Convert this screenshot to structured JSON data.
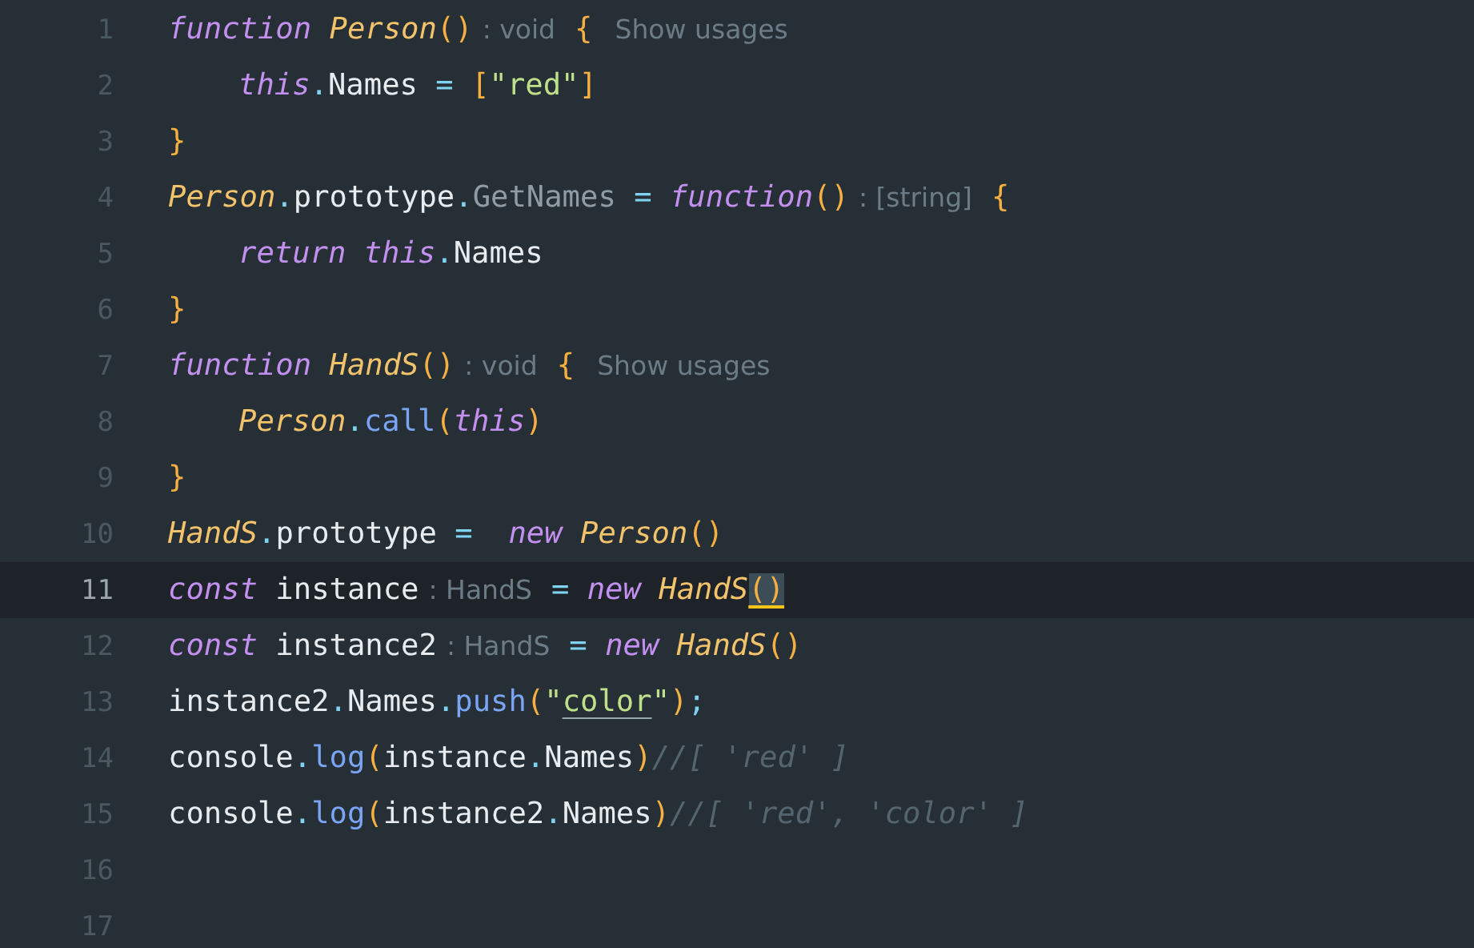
{
  "editor": {
    "lines": [
      {
        "number": "1",
        "current": false,
        "indented": false,
        "tokens": [
          {
            "kind": "keyword",
            "text": "function "
          },
          {
            "kind": "function",
            "text": "Person"
          },
          {
            "kind": "brace",
            "text": "()"
          },
          {
            "kind": "hint",
            "text": ": void"
          },
          {
            "kind": "brace",
            "text": "{"
          },
          {
            "kind": "usages",
            "text": "Show usages"
          }
        ]
      },
      {
        "number": "2",
        "current": false,
        "indented": true,
        "tokens": [
          {
            "kind": "keyword",
            "text": "this"
          },
          {
            "kind": "punct",
            "text": "."
          },
          {
            "kind": "plain",
            "text": "Names"
          },
          {
            "kind": "punct",
            "text": " = "
          },
          {
            "kind": "brace",
            "text": "["
          },
          {
            "kind": "string",
            "text": "\"red\""
          },
          {
            "kind": "brace",
            "text": "]"
          }
        ]
      },
      {
        "number": "3",
        "current": false,
        "indented": false,
        "tokens": [
          {
            "kind": "brace",
            "text": "}"
          }
        ]
      },
      {
        "number": "4",
        "current": false,
        "indented": false,
        "tokens": [
          {
            "kind": "function",
            "text": "Person"
          },
          {
            "kind": "punct",
            "text": "."
          },
          {
            "kind": "plain",
            "text": "prototype"
          },
          {
            "kind": "punct",
            "text": "."
          },
          {
            "kind": "property",
            "text": "GetNames"
          },
          {
            "kind": "punct",
            "text": " = "
          },
          {
            "kind": "keyword",
            "text": "function"
          },
          {
            "kind": "brace",
            "text": "()"
          },
          {
            "kind": "hint",
            "text": ": [string]"
          },
          {
            "kind": "brace",
            "text": "{"
          }
        ]
      },
      {
        "number": "5",
        "current": false,
        "indented": true,
        "tokens": [
          {
            "kind": "keyword",
            "text": "return this"
          },
          {
            "kind": "punct",
            "text": "."
          },
          {
            "kind": "plain",
            "text": "Names"
          }
        ]
      },
      {
        "number": "6",
        "current": false,
        "indented": false,
        "tokens": [
          {
            "kind": "brace",
            "text": "}"
          }
        ]
      },
      {
        "number": "7",
        "current": false,
        "indented": false,
        "tokens": [
          {
            "kind": "keyword",
            "text": "function "
          },
          {
            "kind": "function",
            "text": "HandS"
          },
          {
            "kind": "brace",
            "text": "()"
          },
          {
            "kind": "hint",
            "text": ": void"
          },
          {
            "kind": "brace",
            "text": "{"
          },
          {
            "kind": "usages",
            "text": "Show usages"
          }
        ]
      },
      {
        "number": "8",
        "current": false,
        "indented": true,
        "tokens": [
          {
            "kind": "function",
            "text": "Person"
          },
          {
            "kind": "punct",
            "text": "."
          },
          {
            "kind": "method",
            "text": "call"
          },
          {
            "kind": "brace",
            "text": "("
          },
          {
            "kind": "keyword",
            "text": "this"
          },
          {
            "kind": "brace",
            "text": ")"
          }
        ]
      },
      {
        "number": "9",
        "current": false,
        "indented": false,
        "tokens": [
          {
            "kind": "brace",
            "text": "}"
          }
        ]
      },
      {
        "number": "10",
        "current": false,
        "indented": false,
        "tokens": [
          {
            "kind": "function",
            "text": "HandS"
          },
          {
            "kind": "punct",
            "text": "."
          },
          {
            "kind": "plain",
            "text": "prototype"
          },
          {
            "kind": "punct",
            "text": " =  "
          },
          {
            "kind": "keyword",
            "text": "new "
          },
          {
            "kind": "function",
            "text": "Person"
          },
          {
            "kind": "brace",
            "text": "()"
          }
        ]
      },
      {
        "number": "11",
        "current": true,
        "indented": false,
        "tokens": [
          {
            "kind": "keyword",
            "text": "const"
          },
          {
            "kind": "plain",
            "text": " instance"
          },
          {
            "kind": "hint",
            "text": ": HandS"
          },
          {
            "kind": "punct",
            "text": "= "
          },
          {
            "kind": "keyword",
            "text": "new "
          },
          {
            "kind": "function",
            "text": "HandS"
          },
          {
            "kind": "brace",
            "text": "()",
            "matched": true
          }
        ]
      },
      {
        "number": "12",
        "current": false,
        "indented": false,
        "tokens": [
          {
            "kind": "keyword",
            "text": "const"
          },
          {
            "kind": "plain",
            "text": " instance2"
          },
          {
            "kind": "hint",
            "text": ": HandS"
          },
          {
            "kind": "punct",
            "text": "= "
          },
          {
            "kind": "keyword",
            "text": "new "
          },
          {
            "kind": "function",
            "text": "HandS"
          },
          {
            "kind": "brace",
            "text": "()"
          }
        ]
      },
      {
        "number": "13",
        "current": false,
        "indented": false,
        "tokens": [
          {
            "kind": "plain",
            "text": "instance2"
          },
          {
            "kind": "punct",
            "text": "."
          },
          {
            "kind": "plain",
            "text": "Names"
          },
          {
            "kind": "punct",
            "text": "."
          },
          {
            "kind": "method",
            "text": "push"
          },
          {
            "kind": "brace",
            "text": "("
          },
          {
            "kind": "string",
            "text": "\""
          },
          {
            "kind": "string",
            "text": "color",
            "underlined": true
          },
          {
            "kind": "string",
            "text": "\""
          },
          {
            "kind": "brace",
            "text": ")"
          },
          {
            "kind": "punct",
            "text": ";"
          }
        ]
      },
      {
        "number": "14",
        "current": false,
        "indented": false,
        "tokens": [
          {
            "kind": "plain",
            "text": "console"
          },
          {
            "kind": "punct",
            "text": "."
          },
          {
            "kind": "method",
            "text": "log"
          },
          {
            "kind": "brace",
            "text": "("
          },
          {
            "kind": "plain",
            "text": "instance"
          },
          {
            "kind": "punct",
            "text": "."
          },
          {
            "kind": "plain",
            "text": "Names"
          },
          {
            "kind": "brace",
            "text": ")"
          },
          {
            "kind": "comment",
            "text": "//[ 'red' ]"
          }
        ]
      },
      {
        "number": "15",
        "current": false,
        "indented": false,
        "tokens": [
          {
            "kind": "plain",
            "text": "console"
          },
          {
            "kind": "punct",
            "text": "."
          },
          {
            "kind": "method",
            "text": "log"
          },
          {
            "kind": "brace",
            "text": "("
          },
          {
            "kind": "plain",
            "text": "instance2"
          },
          {
            "kind": "punct",
            "text": "."
          },
          {
            "kind": "plain",
            "text": "Names"
          },
          {
            "kind": "brace",
            "text": ")"
          },
          {
            "kind": "comment",
            "text": "//[ 'red', 'color' ]"
          }
        ]
      },
      {
        "number": "16",
        "current": false
      },
      {
        "number": "17",
        "current": false
      }
    ]
  }
}
